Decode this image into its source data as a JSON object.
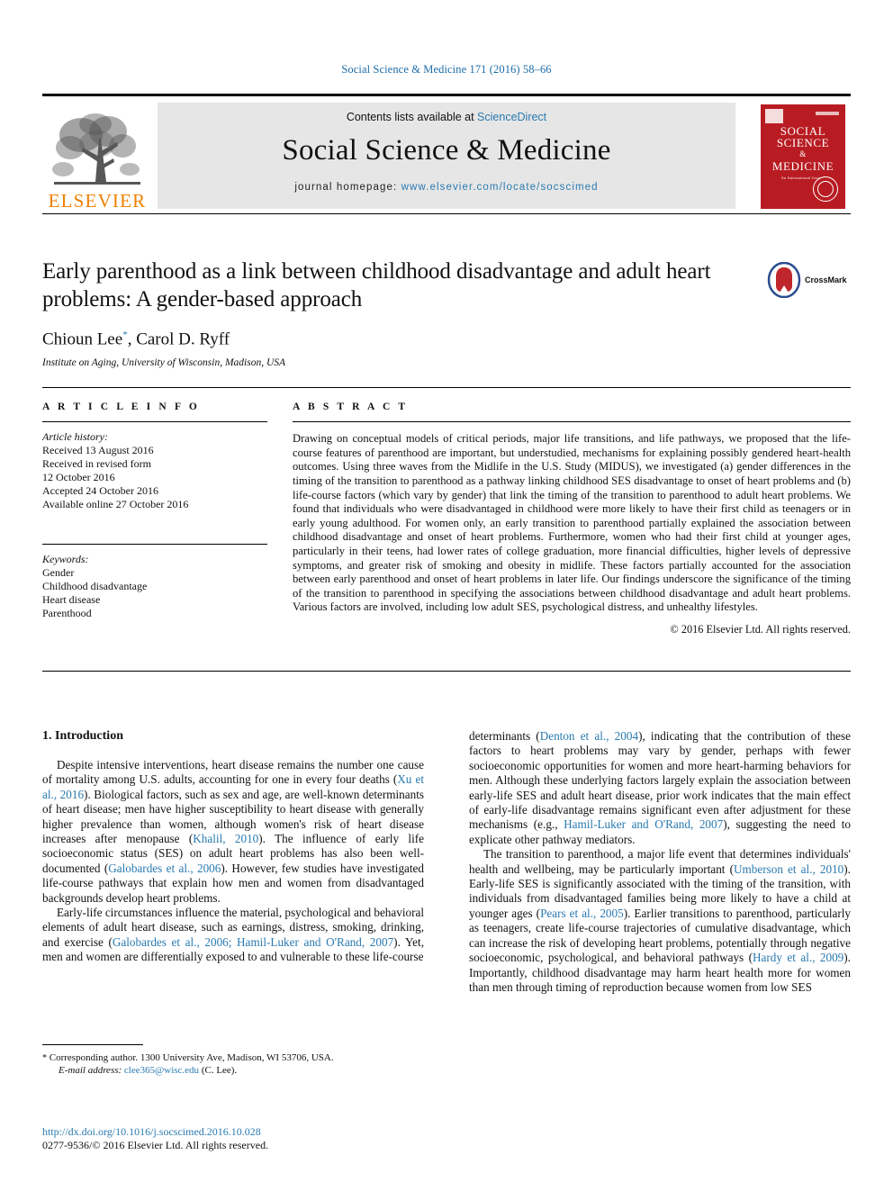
{
  "running_head": "Social Science & Medicine 171 (2016) 58–66",
  "masthead": {
    "contents_prefix": "Contents lists available at ",
    "sciencedirect": "ScienceDirect",
    "journal_name": "Social Science & Medicine",
    "homepage_label": "journal homepage: ",
    "homepage_url": "www.elsevier.com/locate/socscimed",
    "publisher": "ELSEVIER",
    "cover": {
      "line1": "SOCIAL",
      "line2": "SCIENCE",
      "line3": "&",
      "line4": "MEDICINE",
      "subtitle": "An International Journal"
    }
  },
  "article": {
    "title": "Early parenthood as a link between childhood disadvantage and adult heart problems: A gender-based approach",
    "authors": "Chioun Lee",
    "authors_rest": ", Carol D. Ryff",
    "author_marker": "*",
    "affiliation": "Institute on Aging, University of Wisconsin, Madison, USA",
    "crossmark_label": "CrossMark"
  },
  "article_info": {
    "heading": "A R T I C L E    I N F O",
    "history_label": "Article history:",
    "history": [
      "Received 13 August 2016",
      "Received in revised form",
      "12 October 2016",
      "Accepted 24 October 2016",
      "Available online 27 October 2016"
    ],
    "keywords_label": "Keywords:",
    "keywords": [
      "Gender",
      "Childhood disadvantage",
      "Heart disease",
      "Parenthood"
    ]
  },
  "abstract": {
    "heading": "A B S T R A C T",
    "text": "Drawing on conceptual models of critical periods, major life transitions, and life pathways, we proposed that the life-course features of parenthood are important, but understudied, mechanisms for explaining possibly gendered heart-health outcomes. Using three waves from the Midlife in the U.S. Study (MIDUS), we investigated (a) gender differences in the timing of the transition to parenthood as a pathway linking childhood SES disadvantage to onset of heart problems and (b) life-course factors (which vary by gender) that link the timing of the transition to parenthood to adult heart problems. We found that individuals who were disadvantaged in childhood were more likely to have their first child as teenagers or in early young adulthood. For women only, an early transition to parenthood partially explained the association between childhood disadvantage and onset of heart problems. Furthermore, women who had their first child at younger ages, particularly in their teens, had lower rates of college graduation, more financial difficulties, higher levels of depressive symptoms, and greater risk of smoking and obesity in midlife. These factors partially accounted for the association between early parenthood and onset of heart problems in later life. Our findings underscore the significance of the timing of the transition to parenthood in specifying the associations between childhood disadvantage and adult heart problems. Various factors are involved, including low adult SES, psychological distress, and unhealthy lifestyles.",
    "copyright": "© 2016 Elsevier Ltd. All rights reserved."
  },
  "body": {
    "section_heading": "1. Introduction",
    "left_paragraph_1_a": "Despite intensive interventions, heart disease remains the number one cause of mortality among U.S. adults, accounting for one in every four deaths (",
    "left_cite_1": "Xu et al., 2016",
    "left_paragraph_1_b": "). Biological factors, such as sex and age, are well-known determinants of heart disease; men have higher susceptibility to heart disease with generally higher prevalence than women, although women's risk of heart disease increases after menopause (",
    "left_cite_2": "Khalil, 2010",
    "left_paragraph_1_c": "). The influence of early life socioeconomic status (SES) on adult heart problems has also been well-documented (",
    "left_cite_3": "Galobardes et al., 2006",
    "left_paragraph_1_d": "). However, few studies have investigated life-course pathways that explain how men and women from disadvantaged backgrounds develop heart problems.",
    "left_paragraph_2_a": "Early-life circumstances influence the material, psychological and behavioral elements of adult heart disease, such as earnings, distress, smoking, drinking, and exercise (",
    "left_cite_4": "Galobardes et al., 2006; Hamil-Luker and O'Rand, 2007",
    "left_paragraph_2_b": "). Yet, men and women are differentially exposed to and vulnerable to these life-course",
    "right_paragraph_1_a": "determinants (",
    "right_cite_1": "Denton et al., 2004",
    "right_paragraph_1_b": "), indicating that the contribution of these factors to heart problems may vary by gender, perhaps with fewer socioeconomic opportunities for women and more heart-harming behaviors for men. Although these underlying factors largely explain the association between early-life SES and adult heart disease, prior work indicates that the main effect of early-life disadvantage remains significant even after adjustment for these mechanisms (e.g., ",
    "right_cite_2": "Hamil-Luker and O'Rand, 2007",
    "right_paragraph_1_c": "), suggesting the need to explicate other pathway mediators.",
    "right_paragraph_2_a": "The transition to parenthood, a major life event that determines individuals' health and wellbeing, may be particularly important (",
    "right_cite_3": "Umberson et al., 2010",
    "right_paragraph_2_b": "). Early-life SES is significantly associated with the timing of the transition, with individuals from disadvantaged families being more likely to have a child at younger ages (",
    "right_cite_4": "Pears et al., 2005",
    "right_paragraph_2_c": "). Earlier transitions to parenthood, particularly as teenagers, create life-course trajectories of cumulative disadvantage, which can increase the risk of developing heart problems, potentially through negative socioeconomic, psychological, and behavioral pathways (",
    "right_cite_5": "Hardy et al., 2009",
    "right_paragraph_2_d": "). Importantly, childhood disadvantage may harm heart health more for women than men through timing of reproduction because women from low SES"
  },
  "footnote": {
    "marker": "*",
    "corresponding": " Corresponding author. 1300 University Ave, Madison, WI 53706, USA.",
    "email_label": "E-mail address:",
    "email": "clee365@wisc.edu",
    "email_suffix": " (C. Lee)."
  },
  "doi": "http://dx.doi.org/10.1016/j.socscimed.2016.10.028",
  "issn_line": "0277-9536/© 2016 Elsevier Ltd. All rights reserved.",
  "colors": {
    "link": "#2a7ab0",
    "elsevier_orange": "#f08000",
    "cover_red": "#b81c22",
    "band_grey": "#e6e6e6"
  }
}
